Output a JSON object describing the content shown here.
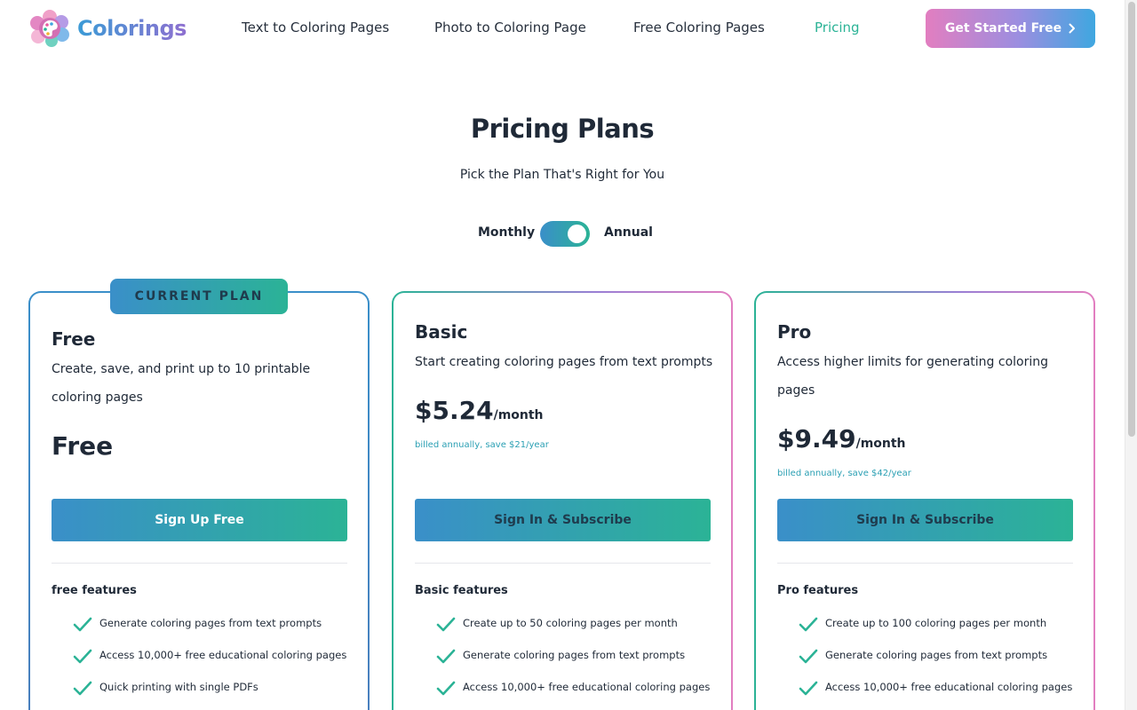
{
  "header": {
    "brand": "Colorings",
    "nav": [
      {
        "label": "Text to Coloring Pages",
        "active": false
      },
      {
        "label": "Photo to Coloring Page",
        "active": false
      },
      {
        "label": "Free Coloring Pages",
        "active": false
      },
      {
        "label": "Pricing",
        "active": true
      }
    ],
    "cta_label": "Get Started Free"
  },
  "hero": {
    "title": "Pricing Plans",
    "subtitle": "Pick the Plan That's Right for You",
    "toggle": {
      "left_label": "Monthly",
      "right_label": "Annual",
      "annual_selected": true
    }
  },
  "plans": [
    {
      "badge": "CURRENT PLAN",
      "name": "Free",
      "description": "Create, save, and print up to 10 printable coloring pages",
      "price": "Free",
      "button": "Sign Up Free",
      "features_title": "free features",
      "features": [
        "Generate coloring pages from text prompts",
        "Access 10,000+ free educational coloring pages",
        "Quick printing with single PDFs"
      ]
    },
    {
      "name": "Basic",
      "description": "Start creating coloring pages from text prompts",
      "price": "$5.24",
      "price_unit": "/month",
      "billing_note": "billed annually, save $21/year",
      "button": "Sign In & Subscribe",
      "features_title": "Basic features",
      "features": [
        "Create up to 50 coloring pages per month",
        "Generate coloring pages from text prompts",
        "Access 10,000+ free educational coloring pages"
      ]
    },
    {
      "name": "Pro",
      "description": "Access higher limits for generating coloring pages",
      "price": "$9.49",
      "price_unit": "/month",
      "billing_note": "billed annually, save $42/year",
      "button": "Sign In & Subscribe",
      "features_title": "Pro features",
      "features": [
        "Create up to 100 coloring pages per month",
        "Generate coloring pages from text prompts",
        "Access 10,000+ free educational coloring pages"
      ]
    }
  ],
  "icons": {
    "logo": "palette-flower-icon",
    "cta": "chevron-right-icon",
    "feature": "checkmark-icon"
  },
  "colors": {
    "accent_teal": "#2bb396",
    "accent_blue": "#3a8fc9",
    "accent_pink": "#e27ec0",
    "billing_text": "#2a9fb3"
  }
}
